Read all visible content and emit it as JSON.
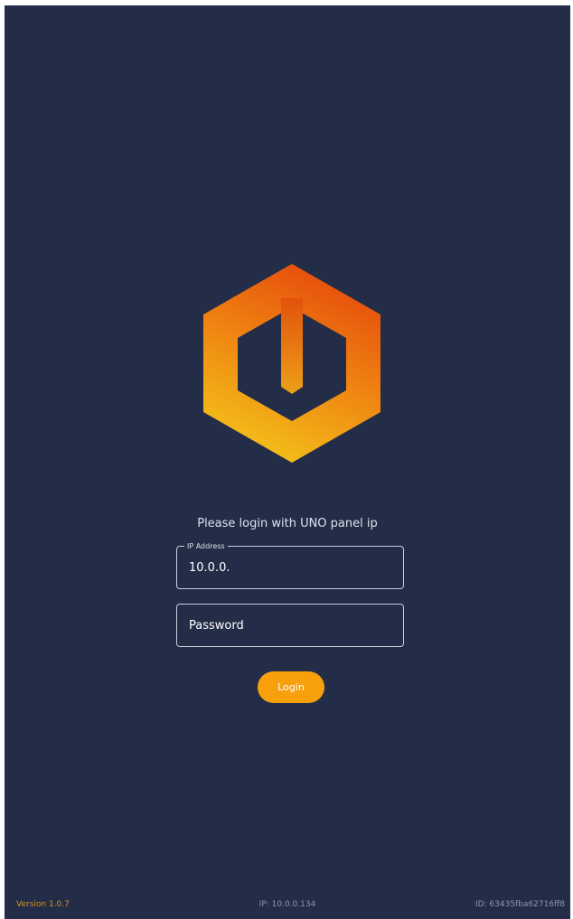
{
  "colors": {
    "background": "#232d48",
    "accent": "#f7a00c",
    "version_text": "#d89314",
    "muted_text": "#8e96ab"
  },
  "logo": {
    "icon": "hexagon-power-logo"
  },
  "login": {
    "prompt": "Please login with UNO panel ip",
    "ip_label": "IP Address",
    "ip_value": "10.0.0.",
    "password_placeholder": "Password",
    "button_label": "Login"
  },
  "footer": {
    "version": "Version 1.0.7",
    "ip": "IP: 10.0.0.134",
    "id": "ID: 63435fba62716ff8"
  }
}
